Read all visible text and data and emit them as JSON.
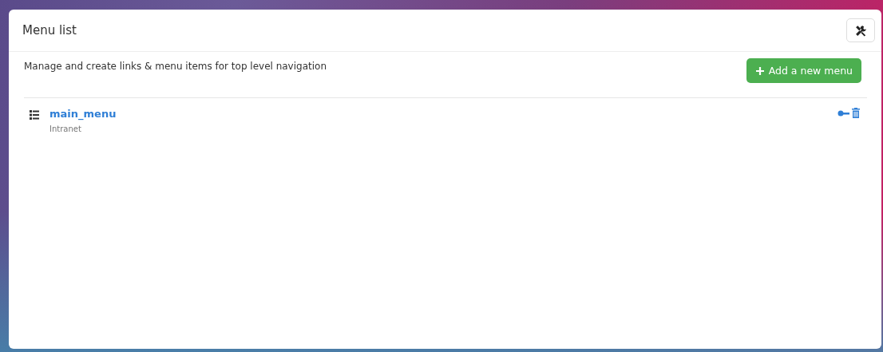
{
  "card": {
    "title": "Menu list"
  },
  "description": "Manage and create links & menu items for top level navigation",
  "add_button": {
    "label": "Add a new menu"
  },
  "menus": [
    {
      "name": "main_menu",
      "subtitle": "Intranet"
    }
  ]
}
